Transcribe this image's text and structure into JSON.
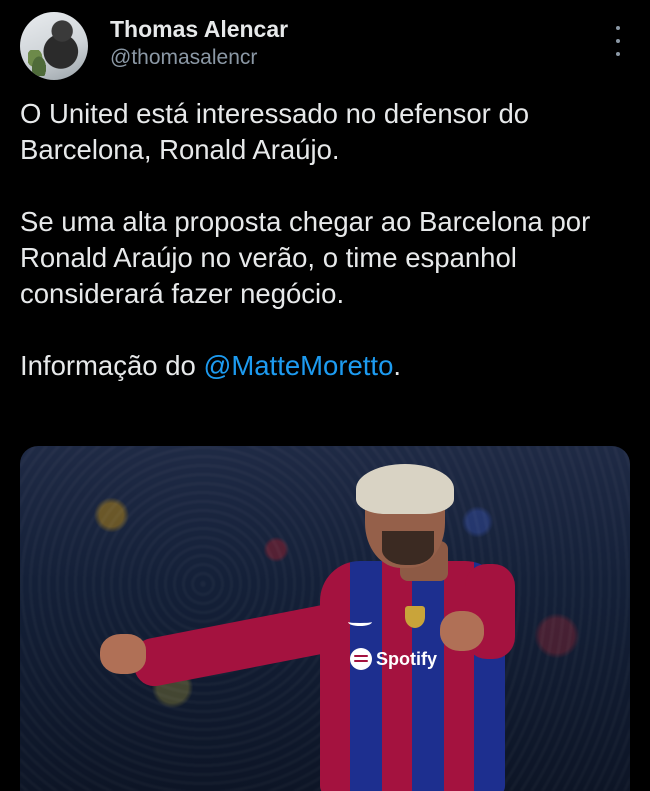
{
  "author": {
    "name": "Thomas Alencar",
    "handle": "@thomasalencr"
  },
  "tweet": {
    "paragraph_1": "O United está interessado no defensor do Barcelona, Ronald Araújo.",
    "paragraph_2": "Se uma alta proposta chegar ao Barcelona por Ronald Araújo no verão, o time espanhol considerará fazer negócio.",
    "paragraph_3_prefix": "Informação do ",
    "paragraph_3_mention": "@MatteMoretto",
    "paragraph_3_suffix": "."
  },
  "media": {
    "sponsor_text": "Spotify"
  },
  "colors": {
    "background": "#000000",
    "text": "#e7e9ea",
    "secondary_text": "#8b98a5",
    "link": "#1d9bf0"
  },
  "icons": {
    "more": "more-vertical-icon"
  }
}
